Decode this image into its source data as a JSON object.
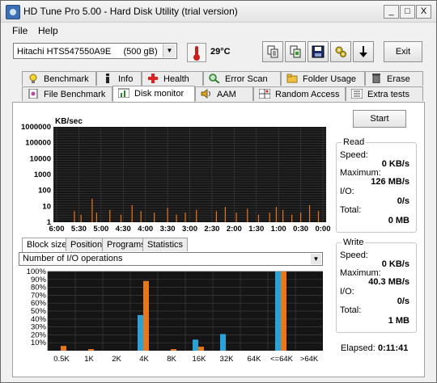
{
  "window": {
    "title": "HD Tune Pro 5.00 - Hard Disk Utility (trial version)",
    "controls": [
      "_",
      "□",
      "X"
    ]
  },
  "menu": [
    "File",
    "Help"
  ],
  "toolbar": {
    "drive": "Hitachi HTS547550A9E     (500 gB)",
    "temperature": "29°C",
    "exit_label": "Exit",
    "icons": [
      "copy-text-icon",
      "copy-screenshot-icon",
      "save-icon",
      "options-icon",
      "down-arrow-icon"
    ]
  },
  "tabs_row1": [
    {
      "label": "Benchmark",
      "icon": "bulb-icon"
    },
    {
      "label": "Info",
      "icon": "info-icon"
    },
    {
      "label": "Health",
      "icon": "health-icon"
    },
    {
      "label": "Error Scan",
      "icon": "magnifier-icon"
    },
    {
      "label": "Folder Usage",
      "icon": "folder-icon"
    },
    {
      "label": "Erase",
      "icon": "trash-icon"
    }
  ],
  "tabs_row2": [
    {
      "label": "File Benchmark",
      "icon": "file-icon"
    },
    {
      "label": "Disk monitor",
      "icon": "monitor-icon"
    },
    {
      "label": "AAM",
      "icon": "speaker-icon"
    },
    {
      "label": "Random Access",
      "icon": "grid-icon"
    },
    {
      "label": "Extra tests",
      "icon": "list-icon"
    }
  ],
  "start_label": "Start",
  "read": {
    "title": "Read",
    "speed_label": "Speed:",
    "speed_value": "0 KB/s",
    "max_label": "Maximum:",
    "max_value": "126 MB/s",
    "io_label": "I/O:",
    "io_value": "0/s",
    "total_label": "Total:",
    "total_value": "0 MB"
  },
  "write": {
    "title": "Write",
    "speed_label": "Speed:",
    "speed_value": "0 KB/s",
    "max_label": "Maximum:",
    "max_value": "40.3 MB/s",
    "io_label": "I/O:",
    "io_value": "0/s",
    "total_label": "Total:",
    "total_value": "1 MB"
  },
  "subtabs": [
    "Block size",
    "Position",
    "Programs",
    "Statistics"
  ],
  "io_select": "Number of I/O operations",
  "elapsed_label": "Elapsed:",
  "elapsed_value": "0:11:41",
  "colors": {
    "read": "#29a3d6",
    "write": "#e8771c",
    "plot_bg": "#151515",
    "grid": "#3d3d3d"
  },
  "chart_data": [
    {
      "type": "line",
      "title": "KB/sec",
      "yticks": [
        "1000000",
        "100000",
        "10000",
        "1000",
        "100",
        "10",
        "1"
      ],
      "xticks": [
        "6:00",
        "5:30",
        "5:00",
        "4:30",
        "4:00",
        "3:30",
        "3:00",
        "2:30",
        "2:00",
        "1:30",
        "1:00",
        "0:30",
        "0:00"
      ],
      "yscale": "log",
      "ylim": [
        1,
        1000000
      ],
      "xlim_minutes": [
        6,
        0
      ],
      "series": [
        {
          "values": [
            [
              5.6,
              5
            ],
            [
              5.45,
              3
            ],
            [
              5.2,
              30
            ],
            [
              5.1,
              4
            ],
            [
              4.8,
              6
            ],
            [
              4.55,
              3
            ],
            [
              4.3,
              12
            ],
            [
              4.1,
              5
            ],
            [
              3.8,
              4
            ],
            [
              3.5,
              8
            ],
            [
              3.3,
              3
            ],
            [
              3.1,
              4
            ],
            [
              2.85,
              6
            ],
            [
              2.4,
              5
            ],
            [
              2.2,
              9
            ],
            [
              1.95,
              4
            ],
            [
              1.7,
              7
            ],
            [
              1.45,
              3
            ],
            [
              1.2,
              4
            ],
            [
              1.05,
              9
            ],
            [
              0.9,
              6
            ],
            [
              0.7,
              3
            ],
            [
              0.5,
              4
            ],
            [
              0.3,
              12
            ],
            [
              0.1,
              5
            ]
          ]
        }
      ]
    },
    {
      "type": "bar",
      "yticks": [
        "100%",
        "90%",
        "80%",
        "70%",
        "60%",
        "50%",
        "40%",
        "30%",
        "20%",
        "10%"
      ],
      "categories": [
        "0.5K",
        "1K",
        "2K",
        "4K",
        "8K",
        "16K",
        "32K",
        "64K",
        "<=64K",
        ">64K"
      ],
      "ylim": [
        0,
        100
      ],
      "series": [
        {
          "values": [
            0,
            0,
            0,
            45,
            0,
            14,
            21,
            0,
            100,
            0
          ]
        },
        {
          "values": [
            6,
            2,
            0,
            88,
            2,
            5,
            0,
            0,
            100,
            0
          ]
        }
      ]
    }
  ]
}
